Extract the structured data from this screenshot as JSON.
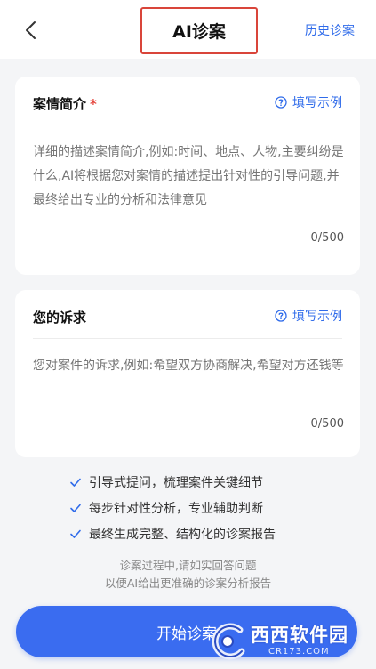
{
  "header": {
    "title": "AI诊案",
    "history_label": "历史诊案"
  },
  "case_card": {
    "title": "案情简介",
    "required_mark": "*",
    "example_label": "填写示例",
    "placeholder": "详细的描述案情简介,例如:时间、地点、人物,主要纠纷是什么,AI将根据您对案情的描述提出针对性的引导问题,并最终给出专业的分析和法律意见",
    "value": "",
    "counter": "0/500"
  },
  "claim_card": {
    "title": "您的诉求",
    "example_label": "填写示例",
    "placeholder": "您对案件的诉求,例如:希望双方协商解决,希望对方还钱等",
    "value": "",
    "counter": "0/500"
  },
  "features": [
    "引导式提问，梳理案件关键细节",
    "每步针对性分析，专业辅助判断",
    "最终生成完整、结构化的诊案报告"
  ],
  "tips": {
    "line1": "诊案过程中,请如实回答问题",
    "line2": "以便AI给出更准确的诊案分析报告"
  },
  "start_button": {
    "label": "开始诊案"
  },
  "watermark": {
    "text": "西西软件园",
    "url": "CR173.COM"
  },
  "colors": {
    "accent": "#2f6bea",
    "button": "#3a6cf0",
    "required": "#e5443b",
    "highlight_box": "#d9453a"
  }
}
